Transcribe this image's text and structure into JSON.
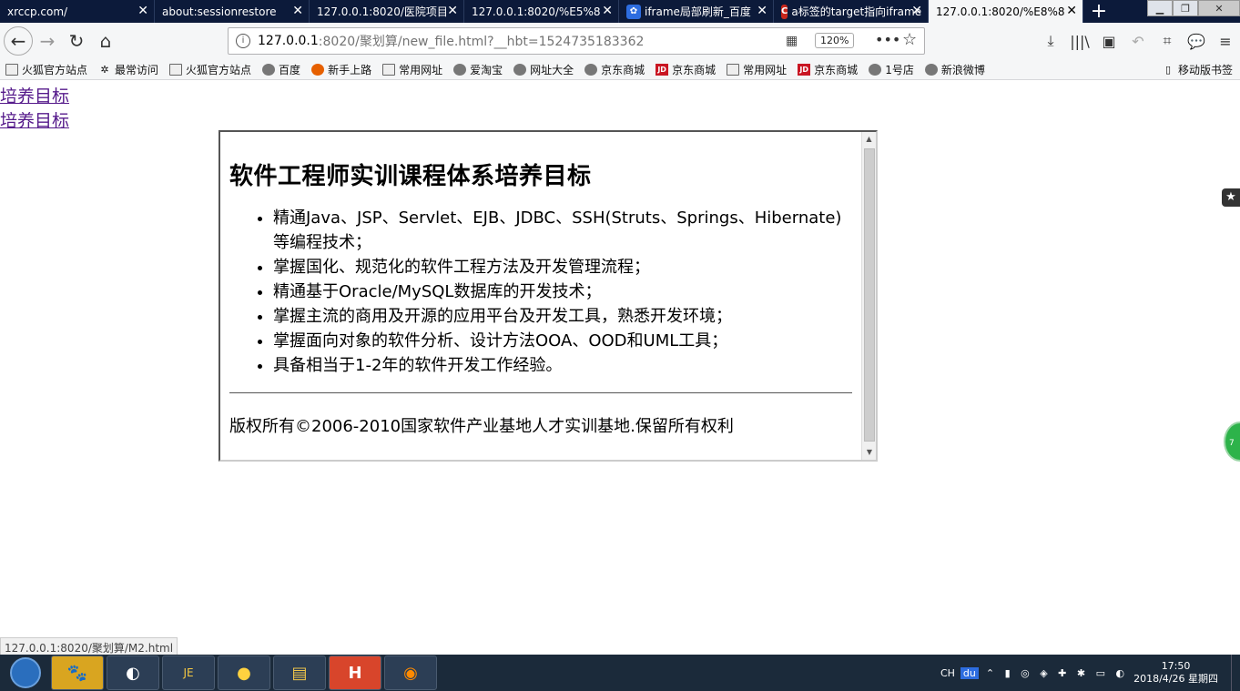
{
  "tabs": [
    {
      "label": "xrccp.com/",
      "active": false,
      "icon": ""
    },
    {
      "label": "about:sessionrestore",
      "active": false,
      "icon": ""
    },
    {
      "label": "127.0.0.1:8020/医院项目",
      "active": false,
      "icon": ""
    },
    {
      "label": "127.0.0.1:8020/%E5%8",
      "active": false,
      "icon": ""
    },
    {
      "label": "iframe局部刷新_百度",
      "active": false,
      "icon": "baidu-paw-icon"
    },
    {
      "label": "a标签的target指向iframe",
      "active": false,
      "icon": "csdn-c-icon"
    },
    {
      "label": "127.0.0.1:8020/%E8%8",
      "active": true,
      "icon": ""
    }
  ],
  "tab_close_glyph": "✕",
  "icons": {
    "csdn_letter": "C",
    "new_tab": "+",
    "back": "←",
    "forward": "→",
    "reload": "↻",
    "home": "⌂",
    "info": "i",
    "qr": "▦",
    "more": "•••",
    "star": "☆",
    "download": "⤓",
    "library": "|||\\",
    "sidebar": "▣",
    "undo": "↶",
    "crop": "⌗",
    "chat": "💬",
    "menu": "≡",
    "bookmark_star": "✱",
    "min": "▁",
    "max": "❐",
    "win_close": "✕",
    "start": ""
  },
  "urlbar": {
    "host": "127.0.0.1",
    "path": ":8020/聚划算/new_file.html?__hbt=1524735183362",
    "zoom": "120%"
  },
  "bookmarks": [
    {
      "label": "火狐官方站点",
      "icon": "folder"
    },
    {
      "label": "最常访问",
      "icon": "gear"
    },
    {
      "label": "火狐官方站点",
      "icon": "folder"
    },
    {
      "label": "百度",
      "icon": "globe"
    },
    {
      "label": "新手上路",
      "icon": "firefox"
    },
    {
      "label": "常用网址",
      "icon": "folder"
    },
    {
      "label": "爱淘宝",
      "icon": "globe"
    },
    {
      "label": "网址大全",
      "icon": "globe"
    },
    {
      "label": "京东商城",
      "icon": "globe"
    },
    {
      "label": "京东商城",
      "icon": "jd"
    },
    {
      "label": "常用网址",
      "icon": "folder"
    },
    {
      "label": "京东商城",
      "icon": "jd"
    },
    {
      "label": "1号店",
      "icon": "globe"
    },
    {
      "label": "新浪微博",
      "icon": "globe"
    }
  ],
  "bookmark_jd_text": "JD",
  "bookmark_mobile": "移动版书签",
  "page": {
    "link1": "培养目标",
    "link2": "培养目标",
    "iframe": {
      "title": "软件工程师实训课程体系培养目标",
      "items": [
        "精通Java、JSP、Servlet、EJB、JDBC、SSH(Struts、Springs、Hibernate)等编程技术；",
        "掌握国化、规范化的软件工程方法及开发管理流程；",
        "精通基于Oracle/MySQL数据库的开发技术；",
        "掌握主流的商用及开源的应用平台及开发工具，熟悉开发环境；",
        "掌握面向对象的软件分析、设计方法OOA、OOD和UML工具；",
        "具备相当于1-2年的软件开发工作经验。"
      ],
      "footer": "版权所有©2006-2010国家软件产业基地人才实训基地.保留所有权利"
    },
    "side_badge": "★",
    "green_badge": "7"
  },
  "status_url": "127.0.0.1:8020/聚划算/M2.html",
  "taskbar": {
    "apps": [
      {
        "name": "baidu-app",
        "glyph": "🐾"
      },
      {
        "name": "eclipse-app",
        "glyph": "◐"
      },
      {
        "name": "java-ee-ide-app",
        "glyph": "JE"
      },
      {
        "name": "chat-app",
        "glyph": "●"
      },
      {
        "name": "explorer-app",
        "glyph": "▤"
      },
      {
        "name": "hbuilder-app",
        "glyph": "H"
      },
      {
        "name": "firefox-app",
        "glyph": "◉"
      }
    ],
    "ime": "CH",
    "du": "du",
    "tray_glyphs": "⌃ ▮ ◎ ◈ ✚ ✱ ▭ ◐",
    "time": "17:50",
    "date": "2018/4/26 星期四"
  },
  "colors": {
    "tabbar": "#0c1a3a",
    "visited_link": "#551a8b"
  }
}
